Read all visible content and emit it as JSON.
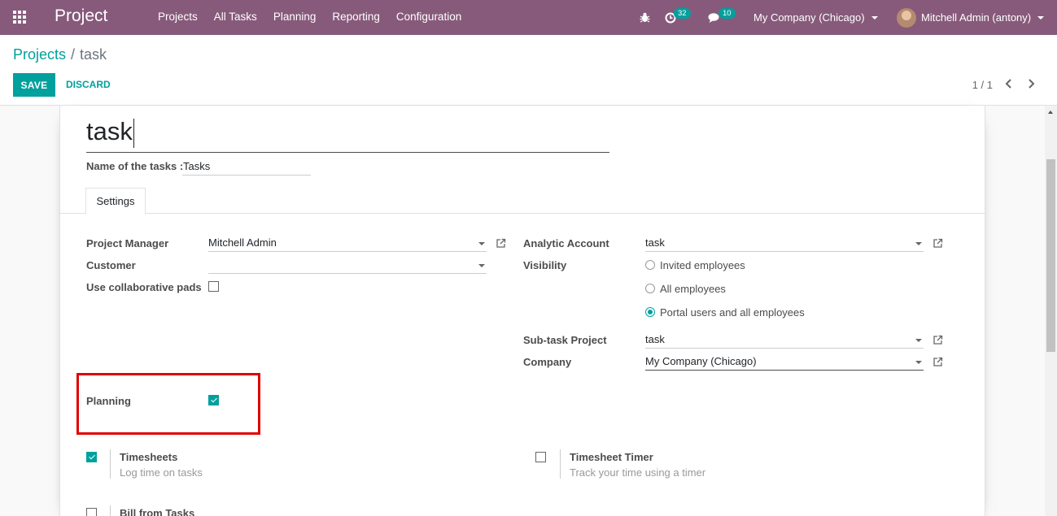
{
  "navbar": {
    "app_title": "Project",
    "menu": [
      "Projects",
      "All Tasks",
      "Planning",
      "Reporting",
      "Configuration"
    ],
    "activity_count": "32",
    "messages_count": "10",
    "company": "My Company (Chicago)",
    "user": "Mitchell Admin (antony)"
  },
  "breadcrumb": {
    "parent": "Projects",
    "separator": "/",
    "current": "task"
  },
  "buttons": {
    "save": "SAVE",
    "discard": "DISCARD"
  },
  "pager": {
    "value": "1 / 1"
  },
  "form": {
    "title": "task",
    "name_tasks_label": "Name of the tasks :",
    "name_tasks_value": "Tasks",
    "tab": "Settings",
    "left": {
      "project_manager_label": "Project Manager",
      "project_manager_value": "Mitchell Admin",
      "customer_label": "Customer",
      "customer_value": "",
      "collab_pads_label": "Use collaborative pads",
      "collab_pads_checked": false,
      "planning_label": "Planning",
      "planning_checked": true
    },
    "right": {
      "analytic_account_label": "Analytic Account",
      "analytic_account_value": "task",
      "visibility_label": "Visibility",
      "visibility_options": [
        "Invited employees",
        "All employees",
        "Portal users and all employees"
      ],
      "visibility_selected": "Portal users and all employees",
      "subtask_project_label": "Sub-task Project",
      "subtask_project_value": "task",
      "company_label": "Company",
      "company_value": "My Company (Chicago)"
    },
    "settings": {
      "timesheets_title": "Timesheets",
      "timesheets_help": "Log time on tasks",
      "timesheets_checked": true,
      "timer_title": "Timesheet Timer",
      "timer_help": "Track your time using a timer",
      "timer_checked": false,
      "bill_title": "Bill from Tasks",
      "bill_checked": false
    }
  },
  "colors": {
    "navbar": "#875a7b",
    "accent": "#00a09d",
    "highlight": "#e00000"
  }
}
